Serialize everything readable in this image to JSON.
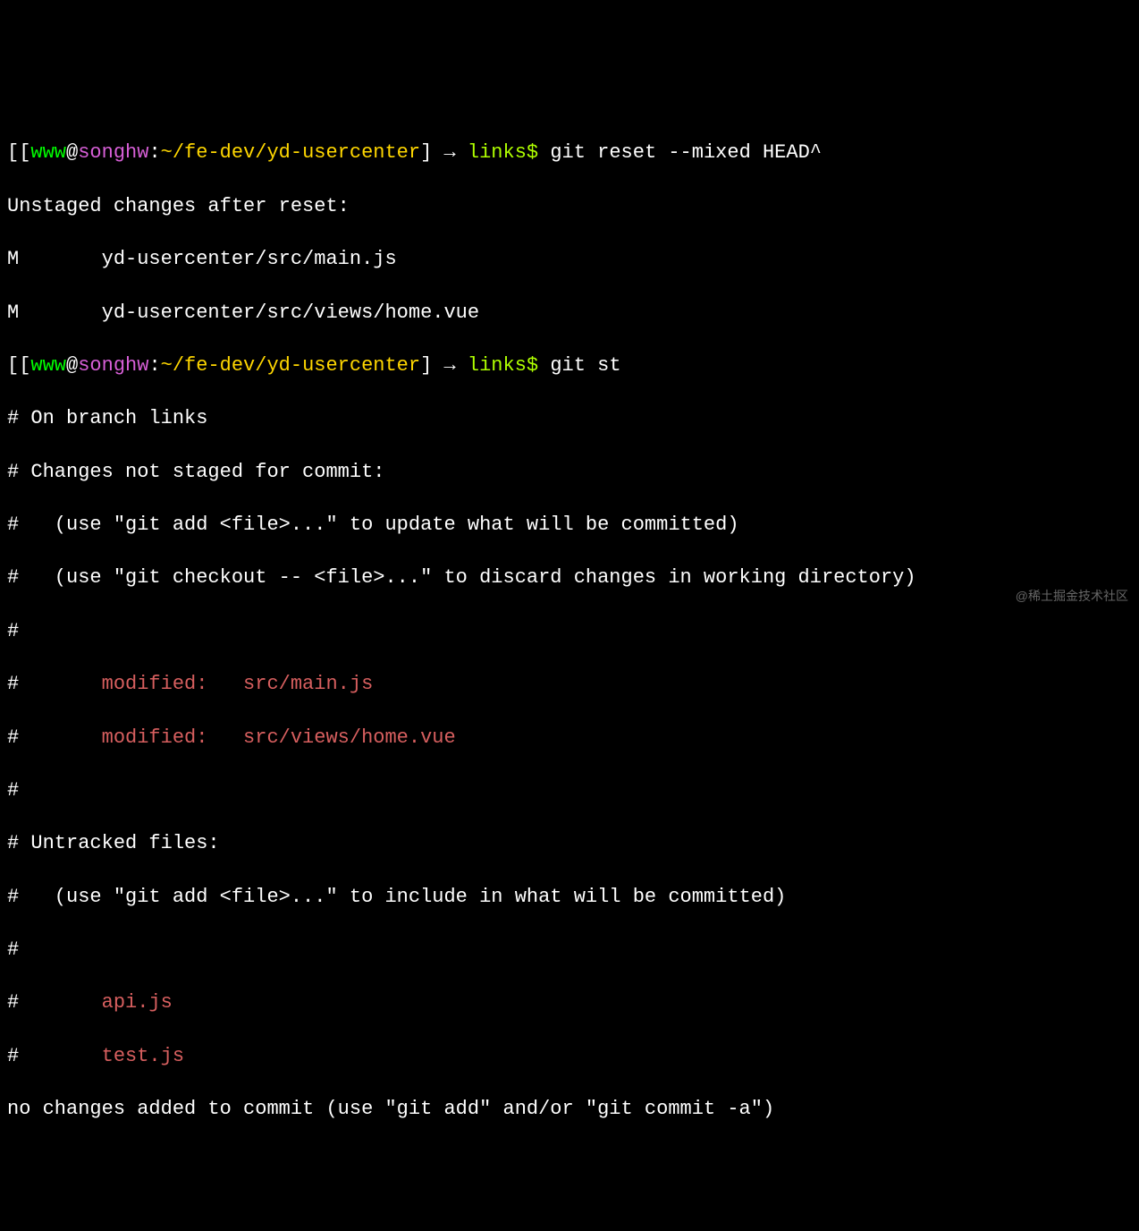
{
  "prompt1": {
    "open": "[[",
    "user": "www",
    "at": "@",
    "host": "songhw",
    "sep": ":",
    "path": "~/fe-dev/yd-usercenter",
    "close": "] → ",
    "branch": "links$ ",
    "command": "git reset --mixed HEAD^"
  },
  "out1": {
    "l1": "Unstaged changes after reset:",
    "l2": "M       yd-usercenter/src/main.js",
    "l3": "M       yd-usercenter/src/views/home.vue"
  },
  "prompt2": {
    "open": "[[",
    "user": "www",
    "at": "@",
    "host": "songhw",
    "sep": ":",
    "path": "~/fe-dev/yd-usercenter",
    "close": "] → ",
    "branch": "links$ ",
    "command": "git st"
  },
  "status": {
    "l1": "# On branch links",
    "l2": "# Changes not staged for commit:",
    "l3": "#   (use \"git add <file>...\" to update what will be committed)",
    "l4": "#   (use \"git checkout -- <file>...\" to discard changes in working directory)",
    "l5": "#",
    "l6a": "#       ",
    "l6b": "modified:   src/main.js",
    "l7a": "#       ",
    "l7b": "modified:   src/views/home.vue",
    "l8": "#",
    "l9": "# Untracked files:",
    "l10": "#   (use \"git add <file>...\" to include in what will be committed)",
    "l11": "#",
    "l12a": "#       ",
    "l12b": "api.js",
    "l13a": "#       ",
    "l13b": "test.js",
    "l14": "no changes added to commit (use \"git add\" and/or \"git commit -a\")"
  },
  "watermark": "@稀土掘金技术社区"
}
